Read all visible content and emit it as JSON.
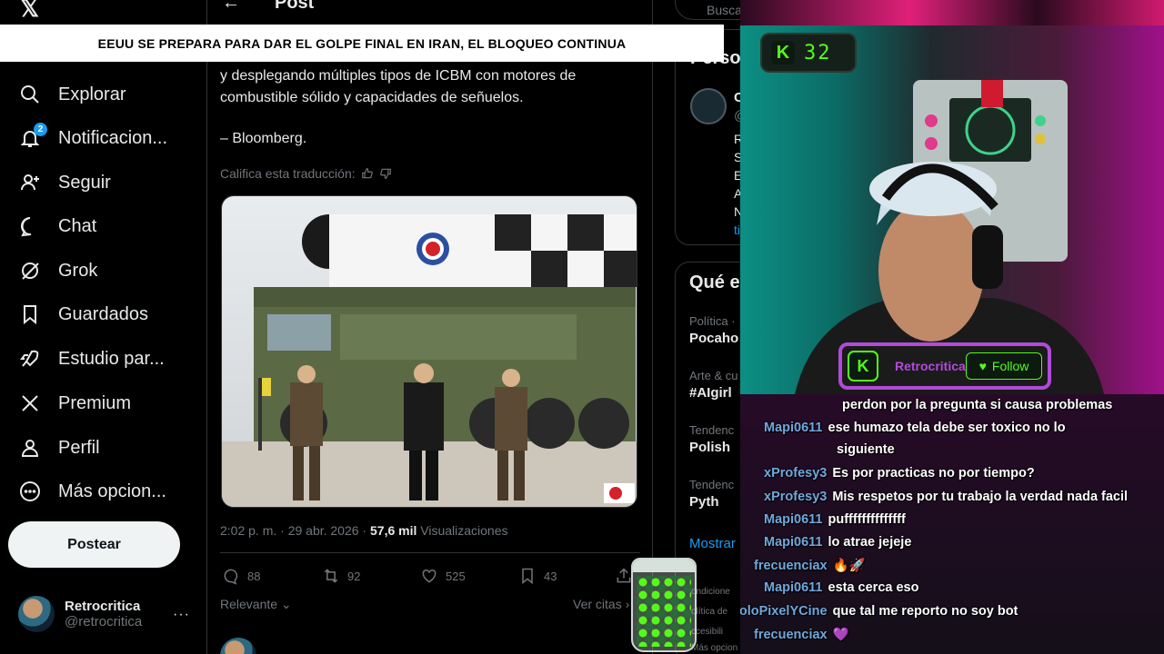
{
  "banner": {
    "headline": "EEUU SE PREPARA PARA DAR EL GOLPE FINAL EN IRAN, EL BLOQUEO CONTINUA"
  },
  "nav": {
    "logo": "𝕏",
    "items": [
      {
        "label": "Explorar",
        "icon": "search-icon"
      },
      {
        "label": "Notificacion...",
        "icon": "bell-icon",
        "badge": "2"
      },
      {
        "label": "Seguir",
        "icon": "follow-icon"
      },
      {
        "label": "Chat",
        "icon": "chat-icon"
      },
      {
        "label": "Grok",
        "icon": "grok-icon"
      },
      {
        "label": "Guardados",
        "icon": "bookmark-icon"
      },
      {
        "label": "Estudio par...",
        "icon": "rocket-icon"
      },
      {
        "label": "Premium",
        "icon": "x-icon"
      },
      {
        "label": "Perfil",
        "icon": "person-icon"
      },
      {
        "label": "Más opcion...",
        "icon": "more-circle-icon"
      }
    ],
    "post_button": "Postear",
    "profile": {
      "name": "Retrocritica",
      "handle": "@retrocritica",
      "menu": "···"
    }
  },
  "post": {
    "header_title": "Post",
    "text": "y desplegando múltiples tipos de ICBM con motores de combustible sólido y capacidades de señuelos.",
    "signature": "– Bloomberg.",
    "rate_label": "Califica esta traducción:",
    "timestamp": "2:02 p. m. · 29 abr. 2026 ·",
    "views_count": "57,6 mil",
    "views_label": "Visualizaciones",
    "stats": {
      "replies": "88",
      "reposts": "92",
      "likes": "525",
      "bookmarks": "43"
    },
    "sort_label": "Relevante",
    "quotes_label": "Ver citas ›"
  },
  "right": {
    "search_placeholder": "Busca",
    "card1_title": "Perso",
    "card1_lines": [
      "C",
      "@",
      "R",
      "S",
      "E",
      "A",
      "N",
      "ti"
    ],
    "card2_title": "Qué e",
    "trends": [
      {
        "category": "Política ·",
        "name": "Pocaho"
      },
      {
        "category": "Arte & cu",
        "name": "#AIgirl"
      },
      {
        "category": "Tendenc",
        "name": "Polish"
      },
      {
        "category": "Tendenc",
        "name": "Pyth"
      }
    ],
    "show_more": "Mostrar",
    "footer": [
      "ondicione",
      "olítica de",
      "ccesibili",
      "Más opcion"
    ]
  },
  "stream": {
    "kick_count": "32",
    "channel_name": "Retrocritica",
    "follow_label": "Follow",
    "chat": [
      {
        "user": "",
        "text": "perdon por la pregunta si causa problemas"
      },
      {
        "user": "Mapi0611",
        "text": "ese humazo tela debe ser toxico no lo"
      },
      {
        "user": "",
        "text": "siguiente"
      },
      {
        "user": "xProfesy3",
        "text": "Es por practicas no por tiempo?"
      },
      {
        "user": "xProfesy3",
        "text": "Mis respetos por tu trabajo la verdad nada facil"
      },
      {
        "user": "Mapi0611",
        "text": "puffffffffffffff"
      },
      {
        "user": "Mapi0611",
        "text": "lo atrae jejeje"
      },
      {
        "user": "frecuenciax",
        "text": "🔥🚀"
      },
      {
        "user": "Mapi0611",
        "text": "esta cerca eso"
      },
      {
        "user": "poloPixelYCine",
        "text": "que tal me reporto no soy bot"
      },
      {
        "user": "frecuenciax",
        "text": "💜"
      }
    ]
  },
  "colors": {
    "accent": "#1d9bf0",
    "kick_green": "#53fc18",
    "purple": "#b14bd8"
  }
}
